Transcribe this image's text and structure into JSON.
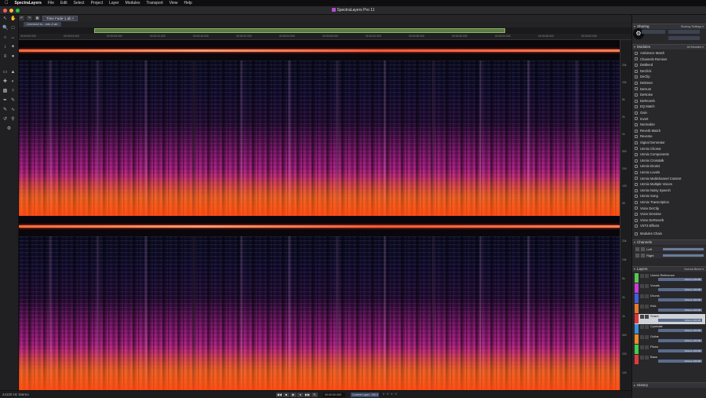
{
  "menubar": {
    "app_name": "SpectraLayers",
    "items": [
      "File",
      "Edit",
      "Select",
      "Project",
      "Layer",
      "Modules",
      "Transport",
      "View",
      "Help"
    ]
  },
  "window": {
    "title": "SpectraLayers Pro 11"
  },
  "tabs": {
    "file_tab": "Time Fade-1.ab ×",
    "project_tab": "Unmixed to...mbr-2.ab"
  },
  "ruler": {
    "ticks": [
      "00:00:00.000",
      "00:00:04.000",
      "00:00:08.000",
      "00:00:12.000",
      "00:00:16.000",
      "00:00:20.000",
      "00:00:24.000",
      "00:00:28.000",
      "00:00:32.000",
      "00:00:36.000",
      "00:00:40.000",
      "00:00:44.000",
      "00:00:48.000",
      "00:00:52.000"
    ]
  },
  "freq_axis": [
    "20k",
    "10k",
    "5k",
    "2k",
    "1k",
    "500",
    "200",
    "100",
    "50",
    "20k",
    "10k",
    "5k",
    "2k",
    "1k",
    "500",
    "200",
    "100"
  ],
  "right_panel": {
    "sharing": {
      "title": "Sharing",
      "option": "Sharing Settings ▾"
    },
    "modules": {
      "title": "Modules",
      "option": "All Modules ▾",
      "items": [
        "Ambience Match",
        "Channels Remixer",
        "DeBleed",
        "DeClick",
        "DeClip",
        "DeEsser",
        "DeHum",
        "DeNoise",
        "DeReverb",
        "EQ Match",
        "Gain",
        "Invert",
        "Normalize",
        "Reverb Match",
        "Reverse",
        "Signal Generator",
        "Unmix Chorus",
        "Unmix Components",
        "Unmix Crosstalk",
        "Unmix Drums",
        "Unmix Levels",
        "Unmix Multichannel Content",
        "Unmix Multiple Voices",
        "Unmix Noisy Speech",
        "Unmix Song",
        "Unmix Transcription",
        "Voice DeClip",
        "Voice Denoise",
        "Voice DeReverb",
        "VST3 Effects",
        "Modules Chain"
      ]
    },
    "channels": {
      "title": "Channels",
      "items": [
        "Left",
        "Right"
      ]
    },
    "layers": {
      "title": "Layers",
      "option": "Normal Blend ▾",
      "items": [
        {
          "name": "Unmix Reference",
          "color": "#57c84d",
          "volume": "Volume 100 dB"
        },
        {
          "name": "Vocals",
          "color": "#c93bd8",
          "volume": "Volume 100 dB"
        },
        {
          "name": "Drums",
          "color": "#3d5fe0",
          "volume": "Volume 100 dB"
        },
        {
          "name": "Kick",
          "color": "#e6792b",
          "volume": "Volume 100 dB"
        },
        {
          "name": "Snare",
          "color": "#e23535",
          "volume": "Volume 100 dB"
        },
        {
          "name": "Cymbals",
          "color": "#3a8ed8",
          "volume": "Volume 100 dB"
        },
        {
          "name": "Guitar",
          "color": "#ee8a2a",
          "volume": "Volume 100 dB"
        },
        {
          "name": "Piano",
          "color": "#3fcf4a",
          "volume": "Volume 100 dB"
        },
        {
          "name": "Bass",
          "color": "#e03a3a",
          "volume": "Volume 100 dB"
        }
      ]
    },
    "history": {
      "title": "History"
    }
  },
  "status": {
    "format": "44100 Hz Stereo",
    "transport": [
      "◀◀",
      "■",
      "▶",
      "●",
      "▶▶",
      "↻"
    ],
    "position": "00:00:00.000",
    "selection": "Current Layer: 100.0 dB",
    "values": "0 · 0 · 0 · 0"
  },
  "colors": {
    "accent": "#5c7a44",
    "selection": "#cfd2d8"
  }
}
